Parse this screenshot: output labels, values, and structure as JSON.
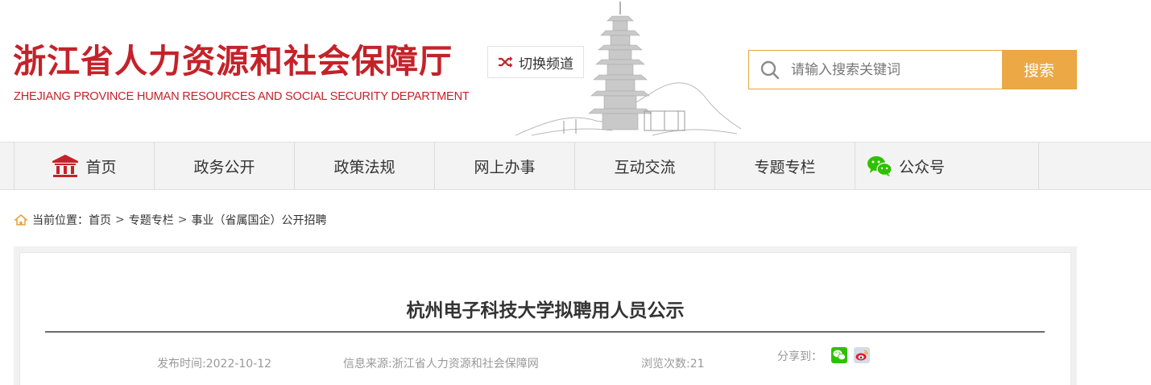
{
  "header": {
    "logo_cn": "浙江省人力资源和社会保障厅",
    "logo_en": "ZHEJIANG PROVINCE HUMAN RESOURCES AND SOCIAL SECURITY DEPARTMENT",
    "switch_channel_label": "切换频道",
    "search_placeholder": "请输入搜索关键词",
    "search_button": "搜索"
  },
  "nav": {
    "items": [
      {
        "label": "首页",
        "icon": "home-icon"
      },
      {
        "label": "政务公开"
      },
      {
        "label": "政策法规"
      },
      {
        "label": "网上办事"
      },
      {
        "label": "互动交流"
      },
      {
        "label": "专题专栏"
      },
      {
        "label": "公众号",
        "icon": "wechat-icon"
      }
    ]
  },
  "breadcrumb": {
    "prefix": "当前位置：",
    "items": [
      "首页",
      "专题专栏",
      "事业（省属国企）公开招聘"
    ],
    "separator": ">"
  },
  "article": {
    "title": "杭州电子科技大学拟聘用人员公示",
    "publish_time": "发布时间:2022-10-12",
    "source": "信息来源:浙江省人力资源和社会保障网",
    "views": "浏览次数:21",
    "share_label": "分享到："
  },
  "colors": {
    "brand_red": "#c4222a",
    "accent_orange": "#eba844",
    "wechat_green": "#2dc100",
    "weibo_red": "#e6162d"
  }
}
